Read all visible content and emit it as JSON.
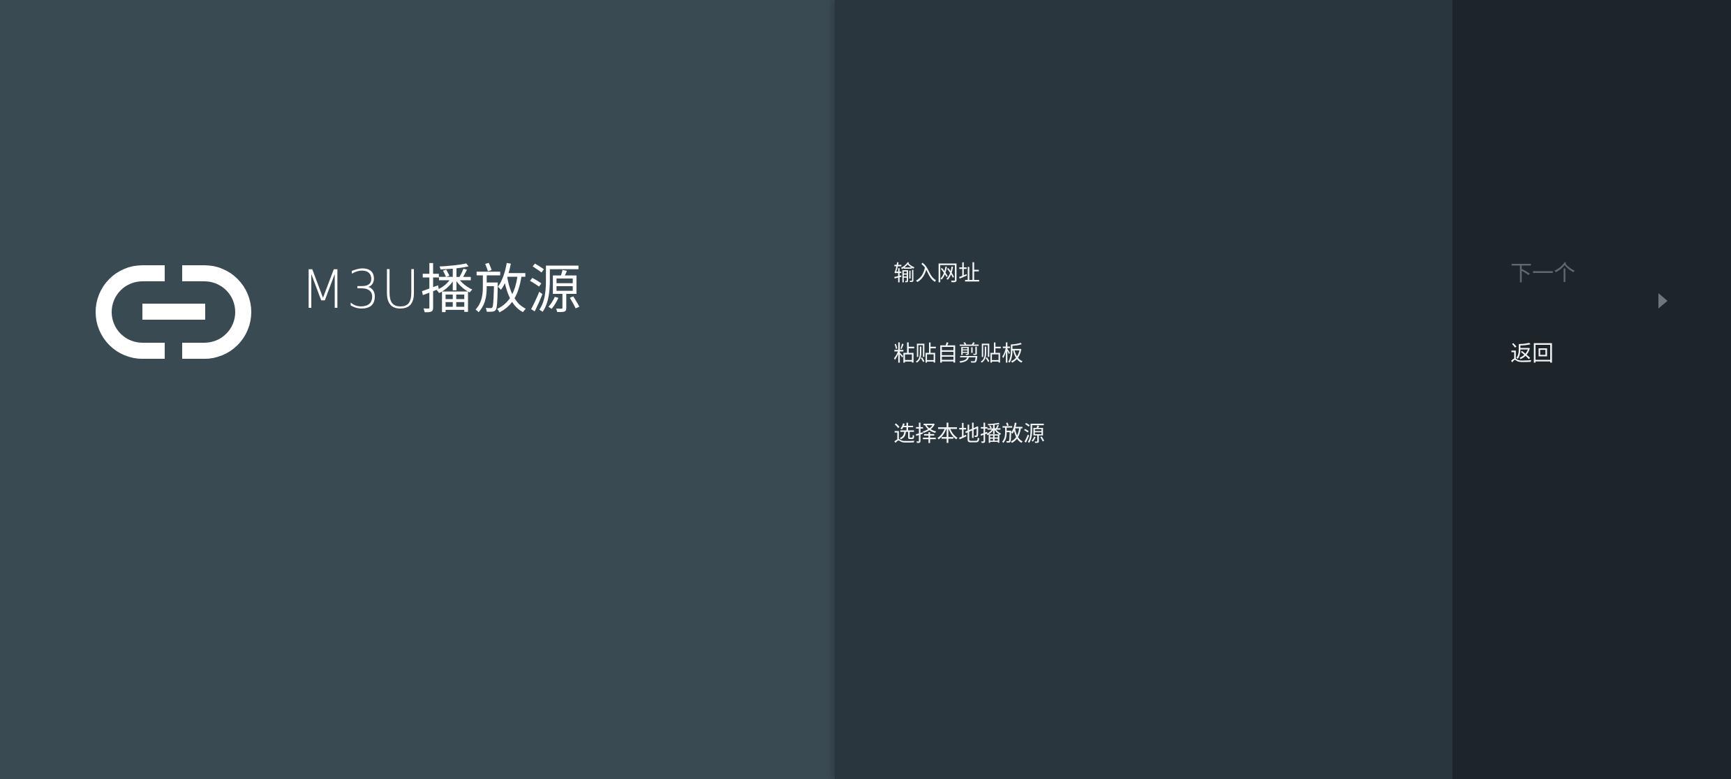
{
  "guidance": {
    "title": "M3U播放源",
    "icon": "link-icon"
  },
  "actions": [
    {
      "label": "输入网址"
    },
    {
      "label": "粘贴自剪贴板"
    },
    {
      "label": "选择本地播放源"
    }
  ],
  "buttons": {
    "next": {
      "label": "下一个",
      "icon": "chevron-right-icon",
      "enabled": false
    },
    "back": {
      "label": "返回",
      "enabled": true
    }
  },
  "colors": {
    "guidance_bg": "#3a4a53",
    "actions_bg": "#2a363d",
    "buttons_bg": "#1e252a",
    "text": "#f2f4f5",
    "disabled_text": "#5d6a71"
  }
}
